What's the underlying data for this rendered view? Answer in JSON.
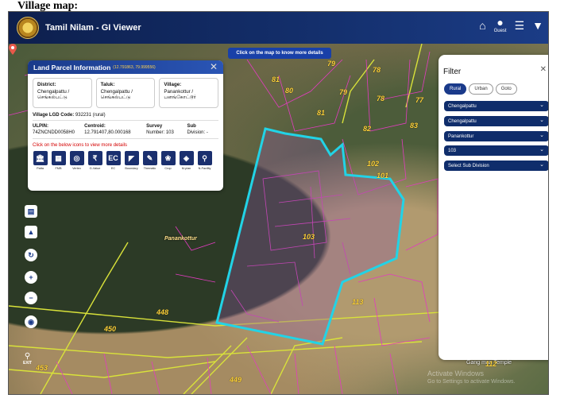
{
  "doc_heading": "Village map:",
  "app": {
    "title": "Tamil Nilam - GI Viewer",
    "guest_label": "Guest"
  },
  "map": {
    "hint": "Click on the map to know more details",
    "village_name": "Panankottur",
    "temple_label": "Gang    man Temple",
    "watermark_1": "Activate Windows",
    "watermark_2": "Go to Settings to activate Windows.",
    "survey_labels": [
      "79",
      "78",
      "81",
      "80",
      "79",
      "78",
      "77",
      "81",
      "83",
      "82",
      "102",
      "101",
      "103",
      "113",
      "448",
      "450",
      "453",
      "449",
      "112"
    ],
    "exit_label": "EXIT"
  },
  "land_parcel": {
    "title": "Land Parcel Information",
    "coords": "(12.791863, 79.999556)",
    "district_label": "District:",
    "district_value": "Chengalpattu / செங்கல்பட்டு",
    "taluk_label": "Taluk:",
    "taluk_value": "Chengalpattu / செங்கல்பட்டு",
    "village_label": "Village:",
    "village_value": "Panankottur / பனங்கோட்டூர்",
    "lgd_label": "Village LGD Code:",
    "lgd_value": "932231 (rural)",
    "ulpin_label": "ULPIN:",
    "ulpin_value": "74ZNCNDD0058H0",
    "centroid_label": "Centroid:",
    "centroid_value": "12.791407,80.000168",
    "survey_label": "Survey",
    "survey_value": "Number: 103",
    "subdiv_label": "Sub",
    "subdiv_value": "Division: -",
    "hint": "Click on the below icons to view more details",
    "icons": [
      "Patta",
      "FMB",
      "Vertex",
      "G-Value",
      "EC",
      "Boundary",
      "Thematic",
      "Crop",
      "M-plan",
      "N-Facility"
    ]
  },
  "filter": {
    "title": "Filter",
    "tabs": [
      "Rural",
      "Urban",
      "Goto"
    ],
    "selects": [
      "Chengalpattu",
      "Chengalpattu",
      "Panankottur",
      "103",
      "Select Sub Division"
    ]
  },
  "colors": {
    "header": "#0d1f4d",
    "accent": "#1a3a8a",
    "boundary": "#22d3e6",
    "parcel_line": "#e23cc0",
    "road": "#d9e23a"
  }
}
